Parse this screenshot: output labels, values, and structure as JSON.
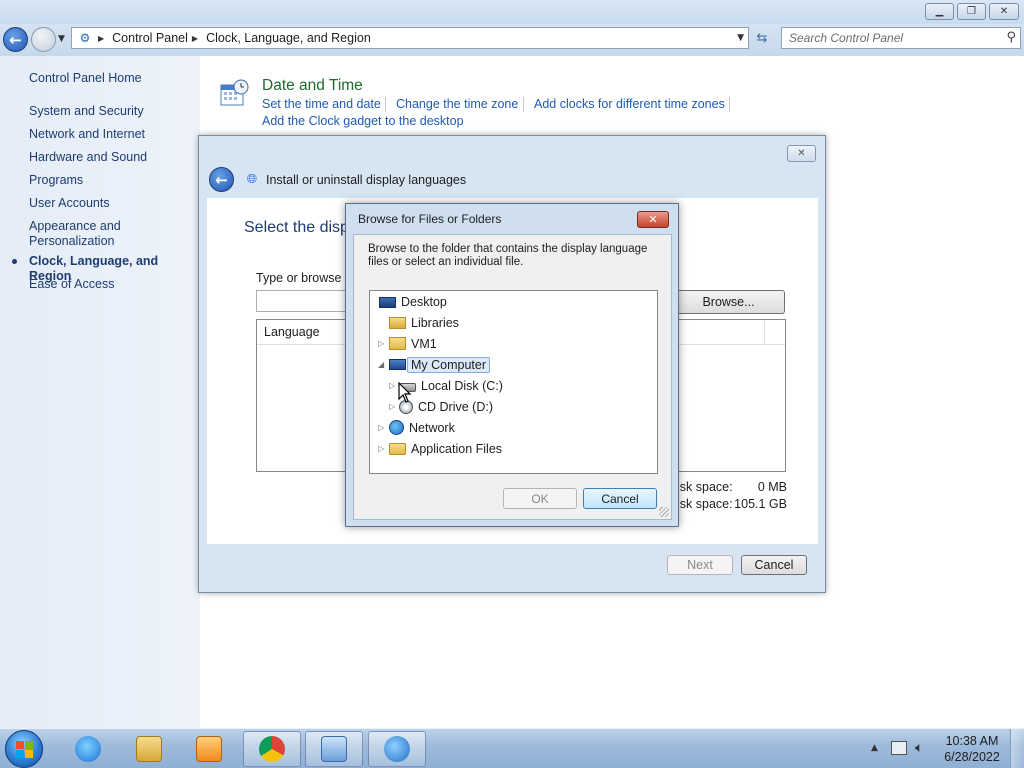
{
  "window": {
    "minimize_icon": "minimize-icon",
    "maximize_icon": "restore-icon",
    "close_icon": "close-icon"
  },
  "address": {
    "crumbs": [
      "Control Panel",
      "Clock, Language, and Region"
    ],
    "search_placeholder": "Search Control Panel"
  },
  "sidebar": {
    "home": "Control Panel Home",
    "items": [
      {
        "label": "System and Security"
      },
      {
        "label": "Network and Internet"
      },
      {
        "label": "Hardware and Sound"
      },
      {
        "label": "Programs"
      },
      {
        "label": "User Accounts"
      },
      {
        "label": "Appearance and Personalization"
      },
      {
        "label": "Clock, Language, and Region",
        "current": true
      },
      {
        "label": "Ease of Access"
      }
    ]
  },
  "datetime": {
    "title": "Date and Time",
    "links": [
      "Set the time and date",
      "Change the time zone",
      "Add clocks for different time zones",
      "Add the Clock gadget to the desktop"
    ]
  },
  "lang_dialog": {
    "title": "Install or uninstall display languages",
    "heading": "Select the disp",
    "type_label": "Type or browse t",
    "browse_label": "Browse...",
    "column_language": "Language",
    "disk_rows": [
      {
        "label": "isk space:",
        "value": "0 MB"
      },
      {
        "label": "isk space:",
        "value": "105.1 GB"
      }
    ],
    "next_label": "Next",
    "cancel_label": "Cancel"
  },
  "browse_dialog": {
    "title": "Browse for Files or Folders",
    "close_glyph": "✕",
    "description": "Browse to the folder that contains the display language files or select an individual file.",
    "tree": [
      {
        "label": "Desktop",
        "icon": "desktop-icon"
      },
      {
        "label": "Libraries",
        "icon": "libraries-icon"
      },
      {
        "label": "VM1",
        "icon": "user-folder-icon"
      },
      {
        "label": "My Computer",
        "icon": "computer-icon",
        "selected": true
      },
      {
        "label": "Local Disk (C:)",
        "icon": "local-disk-icon"
      },
      {
        "label": "CD Drive (D:)",
        "icon": "cd-drive-icon"
      },
      {
        "label": "Network",
        "icon": "network-icon"
      },
      {
        "label": "Application Files",
        "icon": "folder-icon"
      }
    ],
    "ok_label": "OK",
    "cancel_label": "Cancel"
  },
  "taskbar": {
    "items": [
      "internet-explorer-icon",
      "file-explorer-icon",
      "media-player-icon",
      "chrome-icon",
      "control-panel-icon",
      "language-installer-icon"
    ],
    "clock_time": "10:38 AM",
    "clock_date": "6/28/2022"
  }
}
